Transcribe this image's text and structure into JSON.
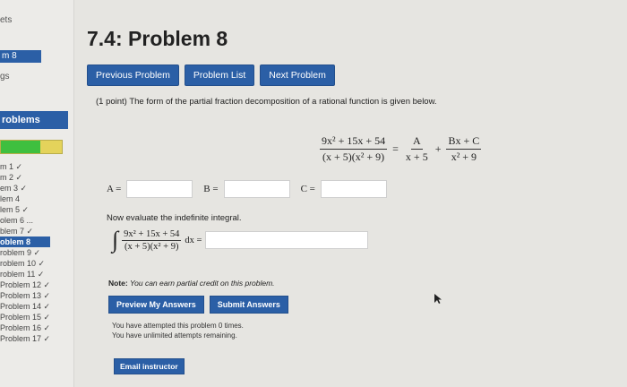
{
  "sidebar": {
    "top_label": "ets",
    "current_set": "m 8",
    "grades_label": "gs",
    "problems_header": "roblems",
    "progress_fraction": 0.64,
    "items": [
      {
        "label": "m 1 ✓",
        "active": false
      },
      {
        "label": "m 2 ✓",
        "active": false
      },
      {
        "label": "em 3 ✓",
        "active": false
      },
      {
        "label": "lem 4",
        "active": false
      },
      {
        "label": "lem 5 ✓",
        "active": false
      },
      {
        "label": "olem 6 ...",
        "active": false
      },
      {
        "label": "blem 7 ✓",
        "active": false
      },
      {
        "label": "oblem 8",
        "active": true
      },
      {
        "label": "roblem 9 ✓",
        "active": false
      },
      {
        "label": "roblem 10 ✓",
        "active": false
      },
      {
        "label": "roblem 11 ✓",
        "active": false
      },
      {
        "label": "Problem 12 ✓",
        "active": false
      },
      {
        "label": "Problem 13 ✓",
        "active": false
      },
      {
        "label": "Problem 14 ✓",
        "active": false
      },
      {
        "label": "Problem 15 ✓",
        "active": false
      },
      {
        "label": "Problem 16 ✓",
        "active": false
      },
      {
        "label": "Problem 17 ✓",
        "active": false
      }
    ]
  },
  "header": {
    "title": "7.4: Problem 8"
  },
  "nav": {
    "prev": "Previous Problem",
    "list": "Problem List",
    "next": "Next Problem"
  },
  "problem": {
    "intro": "(1 point) The form of the partial fraction decomposition of a rational function is given below.",
    "lhs_num": "9x² + 15x + 54",
    "lhs_den": "(x + 5)(x² + 9)",
    "eq_sign": "=",
    "a_num": "A",
    "a_den": "x + 5",
    "plus": "+",
    "b_num": "Bx + C",
    "b_den": "x² + 9",
    "label_a": "A =",
    "label_b": "B =",
    "label_c": "C =",
    "eval_text": "Now evaluate the indefinite integral.",
    "int_sign": "∫",
    "int_num": "9x² + 15x + 54",
    "int_den": "(x + 5)(x² + 9)",
    "int_dx": "dx ="
  },
  "note": {
    "bold": "Note:",
    "text": " You can earn partial credit on this problem."
  },
  "buttons": {
    "preview": "Preview My Answers",
    "submit": "Submit Answers",
    "email": "Email instructor"
  },
  "attempts": {
    "line1": "You have attempted this problem 0 times.",
    "line2": "You have unlimited attempts remaining."
  }
}
